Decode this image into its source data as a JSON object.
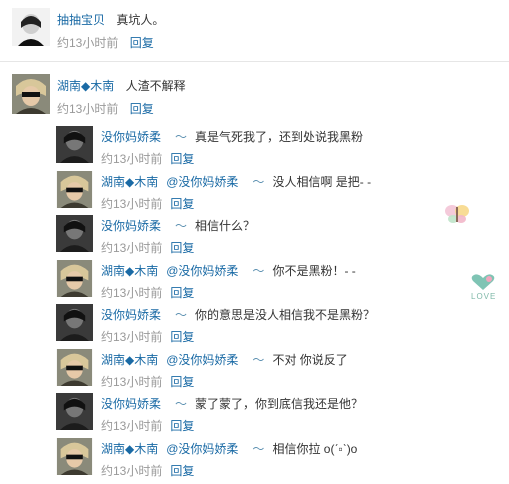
{
  "top_comment": {
    "user": "抽抽宝贝",
    "text": "真坑人。",
    "time": "约13小时前",
    "reply_label": "回复"
  },
  "main_comment": {
    "user": "湖南◆木南",
    "text": "人渣不解释",
    "time": "约13小时前",
    "reply_label": "回复"
  },
  "replies": [
    {
      "user": "没你妈娇柔",
      "tilde": "〜",
      "mention": "",
      "text": "真是气死我了，还到处说我黑粉",
      "time": "约13小时前",
      "reply_label": "回复"
    },
    {
      "user": "湖南◆木南",
      "tilde": "",
      "mention": "@没你妈娇柔",
      "mention_tilde": "〜",
      "text": "没人相信啊 是把- -",
      "time": "约13小时前",
      "reply_label": "回复"
    },
    {
      "user": "没你妈娇柔",
      "tilde": "〜",
      "mention": "",
      "text": "相信什么？",
      "time": "约13小时前",
      "reply_label": "回复"
    },
    {
      "user": "湖南◆木南",
      "tilde": "",
      "mention": "@没你妈娇柔",
      "mention_tilde": "〜",
      "text": "你不是黑粉！- -",
      "time": "约13小时前",
      "reply_label": "回复"
    },
    {
      "user": "没你妈娇柔",
      "tilde": "〜",
      "mention": "",
      "text": "你的意思是没人相信我不是黑粉？",
      "time": "约13小时前",
      "reply_label": "回复"
    },
    {
      "user": "湖南◆木南",
      "tilde": "",
      "mention": "@没你妈娇柔",
      "mention_tilde": "〜",
      "text": "不对  你说反了",
      "time": "约13小时前",
      "reply_label": "回复"
    },
    {
      "user": "没你妈娇柔",
      "tilde": "〜",
      "mention": "",
      "text": "蒙了蒙了，你到底信我还是他？",
      "time": "约13小时前",
      "reply_label": "回复"
    },
    {
      "user": "湖南◆木南",
      "tilde": "",
      "mention": "@没你妈娇柔",
      "mention_tilde": "〜",
      "text": "相信你拉  o(ˊ▫ˋ)o",
      "time": "约13小时前",
      "reply_label": "回复"
    }
  ],
  "stickers": {
    "love_text": "LOVE"
  },
  "colors": {
    "link": "#1a6aa5",
    "meta": "#999999",
    "text": "#333333"
  }
}
